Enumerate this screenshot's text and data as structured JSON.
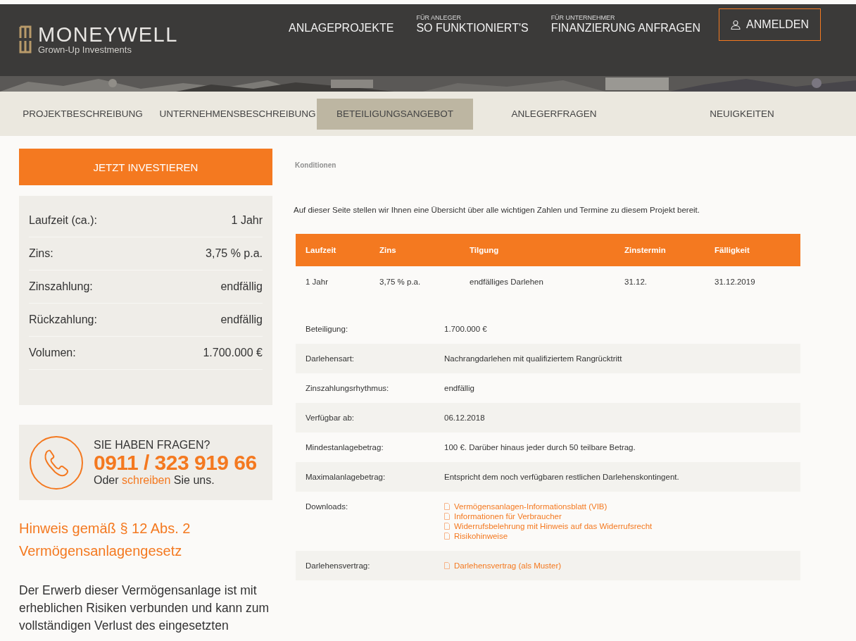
{
  "header": {
    "logo": {
      "name": "MONEYWELL",
      "tagline": "Grown-Up Investments"
    },
    "nav": [
      {
        "label": "ANLAGEPROJEKTE"
      },
      {
        "overline": "FÜR ANLEGER",
        "label": "SO FUNKTIONIERT'S"
      },
      {
        "overline": "FÜR UNTERNEHMER",
        "label": "FINANZIERUNG ANFRAGEN"
      }
    ],
    "login_button": "ANMELDEN"
  },
  "tabs": [
    {
      "label": "PROJEKTBESCHREIBUNG",
      "selected": false
    },
    {
      "label": "UNTERNEHMENSBESCHREIBUNG",
      "selected": false
    },
    {
      "label": "BETEILIGUNGSANGEBOT",
      "selected": true
    },
    {
      "label": "ANLEGERFRAGEN",
      "selected": false
    },
    {
      "label": "NEUIGKEITEN",
      "selected": false
    }
  ],
  "sidebar": {
    "invest_button": "JETZT INVESTIEREN",
    "facts": [
      {
        "label": "Laufzeit (ca.):",
        "value": "1 Jahr"
      },
      {
        "label": "Zins:",
        "value": "3,75 % p.a."
      },
      {
        "label": "Zinszahlung:",
        "value": "endfällig"
      },
      {
        "label": "Rückzahlung:",
        "value": "endfällig"
      },
      {
        "label": "Volumen:",
        "value": "1.700.000 €"
      }
    ],
    "contact": {
      "title": "SIE HABEN FRAGEN?",
      "phone": "0911 / 323 919 66",
      "text_before": "Oder",
      "link": "schreiben",
      "text_after": "Sie uns."
    },
    "notice": {
      "title": "Hinweis gemäß § 12 Abs. 2 Vermögensanlagengesetz",
      "text": "Der Erwerb dieser Vermögensanlage ist mit erheblichen Risiken verbunden und kann zum vollständigen Verlust des eingesetzten"
    }
  },
  "main": {
    "breadcrumb": "Konditionen",
    "intro": "Auf dieser Seite stellen wir Ihnen eine Übersicht über alle wichtigen Zahlen und Termine zu diesem Projekt bereit.",
    "table": {
      "columns": [
        "Laufzeit",
        "Zins",
        "Tilgung",
        "Zinstermin",
        "Fälligkeit"
      ],
      "rows": [
        [
          "1 Jahr",
          "3,75 % p.a.",
          "endfälliges Darlehen",
          "31.12.",
          "31.12.2019"
        ]
      ]
    },
    "details": [
      {
        "kind": "text",
        "label": "Beteiligung:",
        "value": "1.700.000 €"
      },
      {
        "kind": "text",
        "label": "Darlehensart:",
        "value": "Nachrangdarlehen mit qualifiziertem Rangrücktritt"
      },
      {
        "kind": "text",
        "label": "Zinszahlungsrhythmus:",
        "value": "endfällig"
      },
      {
        "kind": "text",
        "label": "Verfügbar ab:",
        "value": "06.12.2018"
      },
      {
        "kind": "text",
        "label": "Mindestanlagebetrag:",
        "value": "100 €. Darüber hinaus jeder durch 50 teilbare Betrag."
      },
      {
        "kind": "text",
        "label": "Maximalanlagebetrag:",
        "value": "Entspricht dem noch verfügbaren restlichen Darlehenskontingent."
      },
      {
        "kind": "links",
        "label": "Downloads:",
        "links": [
          "Vermögensanlagen-Informationsblatt (VIB)",
          "Informationen für Verbraucher",
          "Widerrufsbelehrung mit Hinweis auf das Widerrufsrecht",
          "Risikohinweise"
        ]
      },
      {
        "kind": "links",
        "label": "Darlehensvertrag:",
        "links": [
          "Darlehensvertrag (als Muster)"
        ]
      }
    ]
  }
}
